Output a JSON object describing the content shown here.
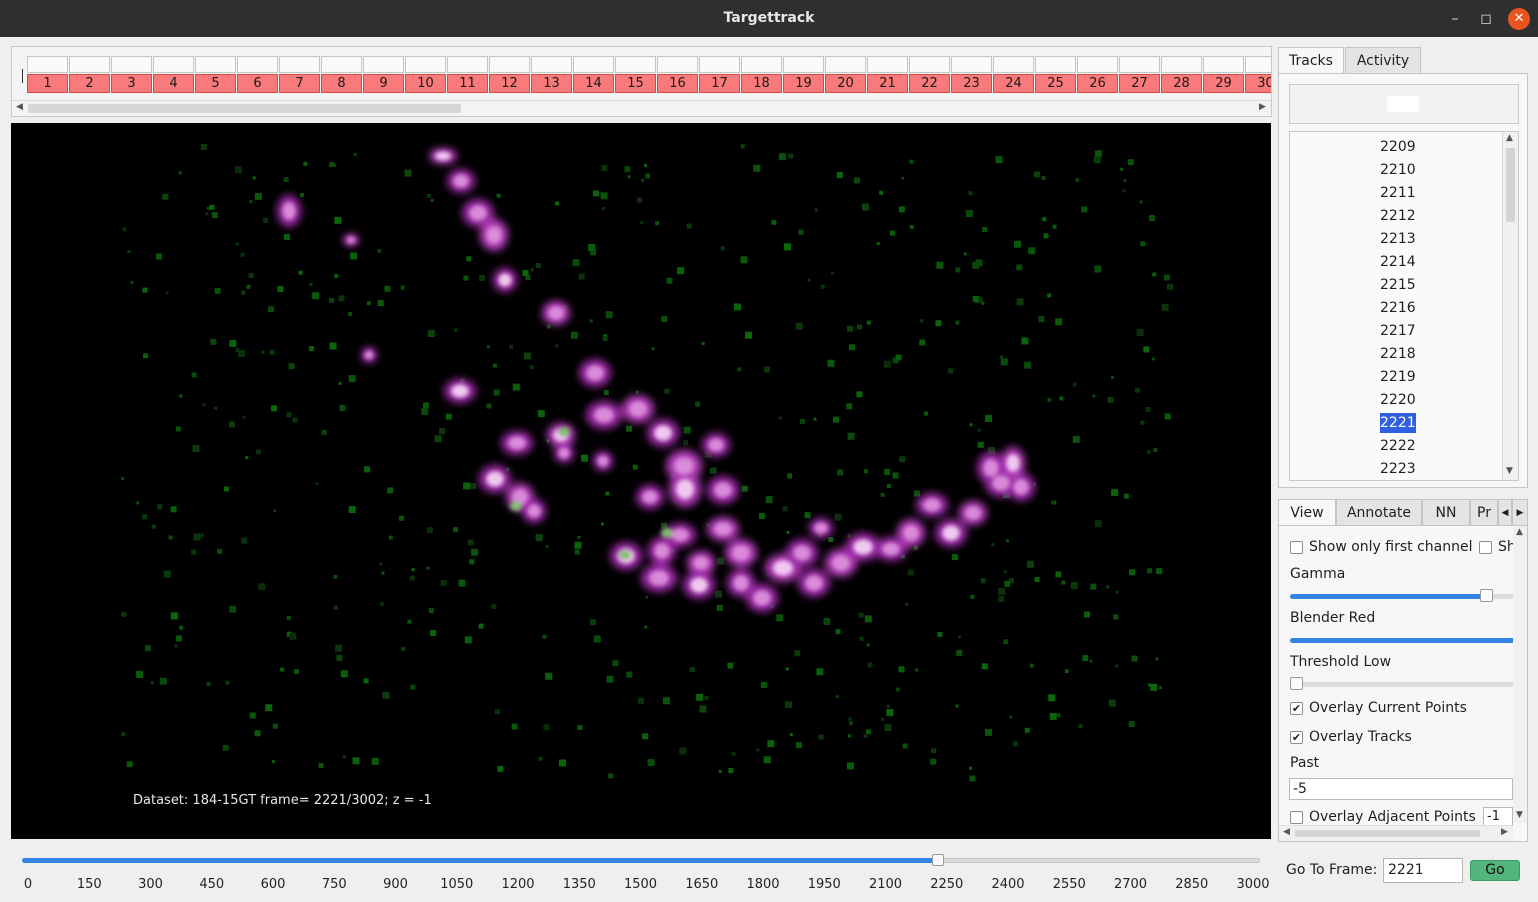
{
  "window": {
    "title": "Targettrack",
    "controls": [
      "minimize-icon",
      "maximize-icon",
      "close-icon"
    ]
  },
  "frame_strip": {
    "labels": [
      "1",
      "2",
      "3",
      "4",
      "5",
      "6",
      "7",
      "8",
      "9",
      "10",
      "11",
      "12",
      "13",
      "14",
      "15",
      "16",
      "17",
      "18",
      "19",
      "20",
      "21",
      "22",
      "23",
      "24",
      "25",
      "26",
      "27",
      "28",
      "29",
      "30"
    ],
    "cell_color": "#f87a7a"
  },
  "viewer": {
    "overlay_text": "Dataset: 184-15GT frame= 2221/3002; z = -1"
  },
  "timeline": {
    "ticks": [
      "0",
      "150",
      "300",
      "450",
      "600",
      "750",
      "900",
      "1050",
      "1200",
      "1350",
      "1500",
      "1650",
      "1800",
      "1950",
      "2100",
      "2250",
      "2400",
      "2550",
      "2700",
      "2850",
      "3000"
    ],
    "current": 2221,
    "min": 0,
    "max": 3002
  },
  "top_tabs": [
    "Tracks",
    "Activity"
  ],
  "tracks": {
    "items": [
      "2209",
      "2210",
      "2211",
      "2212",
      "2213",
      "2214",
      "2215",
      "2216",
      "2217",
      "2218",
      "2219",
      "2220",
      "2221",
      "2222",
      "2223"
    ],
    "selected": "2221",
    "selected_color": "#3060e0"
  },
  "bottom_tabs": [
    "View",
    "Annotate",
    "NN",
    "Pr"
  ],
  "view_panel": {
    "show_first_channel": {
      "label": "Show only first channel",
      "checked": false
    },
    "show_second_truncated": {
      "label": "Sh",
      "checked": false
    },
    "gamma": {
      "label": "Gamma",
      "fraction": 0.87
    },
    "blender_red": {
      "label": "Blender Red",
      "fraction": 1.0
    },
    "threshold_low": {
      "label": "Threshold Low",
      "fraction": 0.0
    },
    "overlay_current_points": {
      "label": "Overlay Current Points",
      "checked": true
    },
    "overlay_tracks": {
      "label": "Overlay Tracks",
      "checked": true
    },
    "past": {
      "label": "Past",
      "value": "-5"
    },
    "overlay_adjacent_points": {
      "label": "Overlay Adjacent Points",
      "checked": false,
      "value": "-1"
    }
  },
  "goto": {
    "label": "Go To Frame:",
    "value": "2221",
    "button": "Go",
    "button_color": "#54b57c"
  }
}
